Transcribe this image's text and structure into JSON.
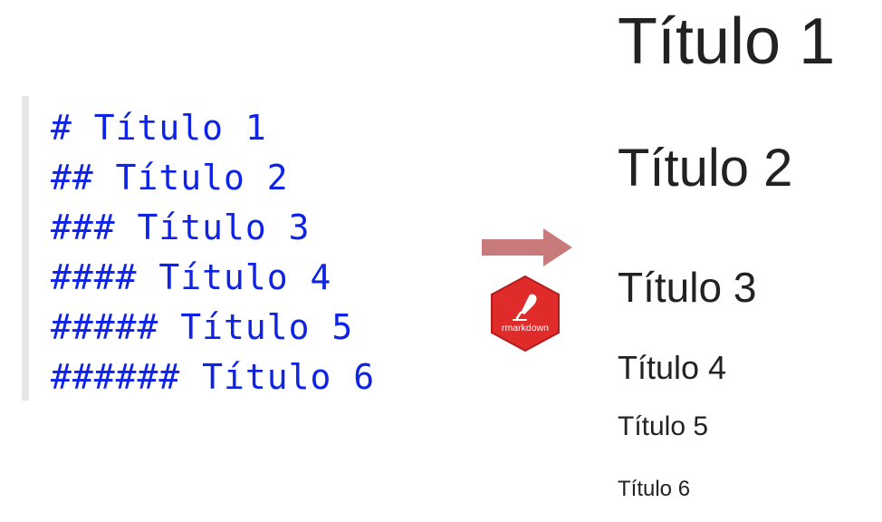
{
  "source": {
    "lines": [
      "# Título 1",
      "## Título 2",
      "### Título 3",
      "#### Título 4",
      "##### Título 5",
      "###### Título 6"
    ],
    "text_color": "#0f23e6"
  },
  "logo": {
    "label": "rmarkdown",
    "color": "#e02b2b"
  },
  "arrow": {
    "color": "#c97a7a"
  },
  "rendered": {
    "headings": [
      "Título 1",
      "Título 2",
      "Título 3",
      "Título 4",
      "Título 5",
      "Título 6"
    ],
    "text_color": "#222222"
  }
}
